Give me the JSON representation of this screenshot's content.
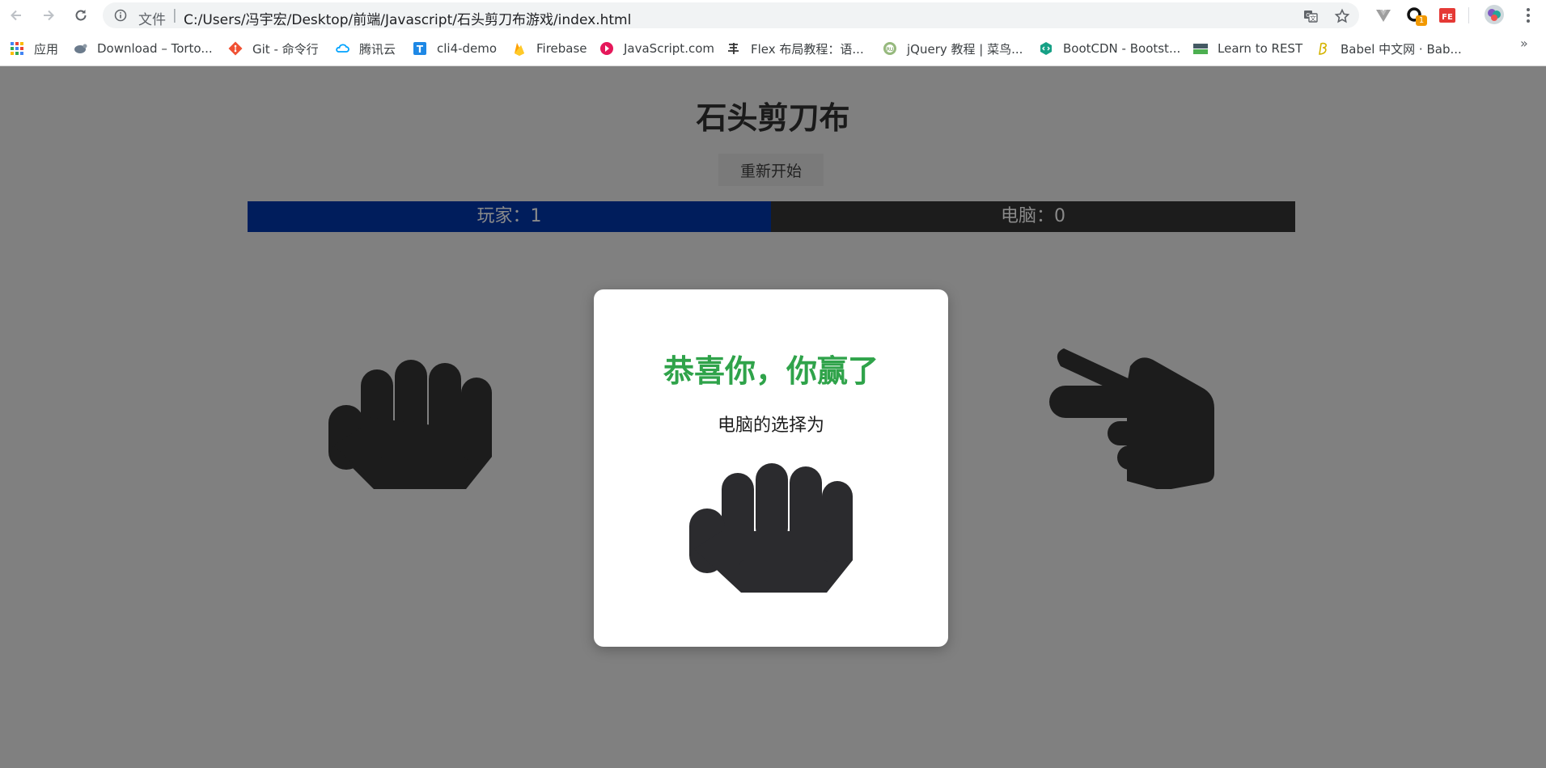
{
  "browser": {
    "omnibox": {
      "scheme_label": "文件",
      "separator": "|",
      "url": "C:/Users/冯宇宏/Desktop/前端/Javascript/石头剪刀布游戏/index.html"
    },
    "extension_badge": "1",
    "bookmarks": [
      {
        "label": "应用",
        "icon": "apps-grid-icon",
        "color": "#4285f4"
      },
      {
        "label": "Download – Torto...",
        "icon": "tortoise-icon",
        "color": "#6b7b8c"
      },
      {
        "label": "Git - 命令行",
        "icon": "git-icon",
        "color": "#f05133"
      },
      {
        "label": "腾讯云",
        "icon": "tencent-cloud-icon",
        "color": "#00a3ff"
      },
      {
        "label": "cli4-demo",
        "icon": "t-logo-icon",
        "color": "#1e88e5"
      },
      {
        "label": "Firebase",
        "icon": "firebase-icon",
        "color": "#ffa000"
      },
      {
        "label": "JavaScript.com",
        "icon": "javascript-com-icon",
        "color": "#e5185a"
      },
      {
        "label": "Flex 布局教程：语...",
        "icon": "calligraphy-icon",
        "color": "#333333"
      },
      {
        "label": "jQuery 教程 | 菜鸟...",
        "icon": "runoob-icon",
        "color": "#96b97d"
      },
      {
        "label": "BootCDN - Bootst...",
        "icon": "bootcdn-icon",
        "color": "#16a085"
      },
      {
        "label": "Learn to REST",
        "icon": "rest-icon",
        "color": "#4caf50"
      },
      {
        "label": "Babel 中文网 · Bab...",
        "icon": "babel-icon",
        "color": "#d4b300"
      }
    ],
    "bookmarks_more": "»"
  },
  "game": {
    "title": "石头剪刀布",
    "restart_label": "重新开始",
    "score": {
      "player": "玩家：1",
      "computer": "电脑：0"
    },
    "player_choice": "rock",
    "computer_choice": "scissors",
    "colors": {
      "background": "#808080",
      "player_bar": "#001d5c",
      "computer_bar": "#1c1c1c",
      "win_text": "#2fa34a",
      "hand": "#1c1c1c"
    }
  },
  "modal": {
    "title": "恭喜你，你赢了",
    "subtitle": "电脑的选择为",
    "computer_choice_icon": "rock-hand-icon"
  }
}
